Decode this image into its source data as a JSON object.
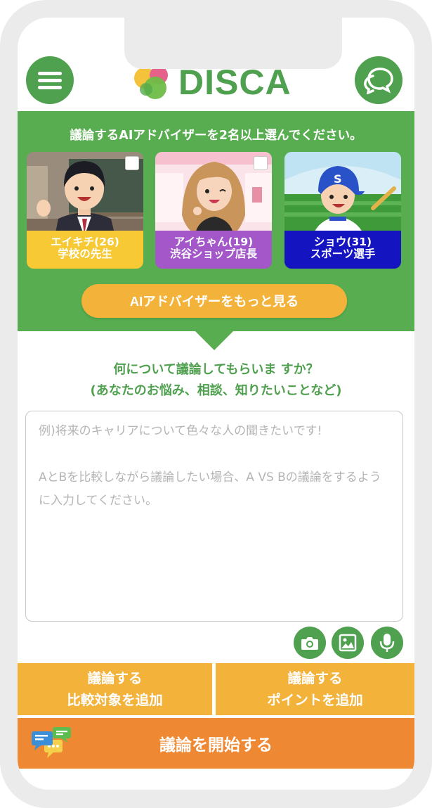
{
  "header": {
    "logo_text": "DISCA",
    "menu_icon": "hamburger-menu-icon",
    "chat_icon": "chat-bubbles-icon"
  },
  "advisor_panel": {
    "title": "議論するAIアドバイザーを2名以上選んでください。",
    "advisors": [
      {
        "name": "エイキチ(26)",
        "role": "学校の先生",
        "caption_color": "#f7c934",
        "text_color": "#ffffff"
      },
      {
        "name": "アイちゃん(19)",
        "role": "渋谷ショップ店長",
        "caption_color": "#a357c9",
        "text_color": "#ffffff"
      },
      {
        "name": "ショウ(31)",
        "role": "スポーツ選手",
        "caption_color": "#1414c0",
        "text_color": "#ffffff"
      }
    ],
    "more_button": "AIアドバイザーをもっと見る"
  },
  "question": {
    "line1": "何について議論してもらいま すか？",
    "line2": "(あなたのお悩み、相談、知りたいことなど)"
  },
  "topic_input": {
    "placeholder": "例)将来のキャリアについて色々な人の聞きたいです!\n\nAとBを比較しながら議論したい場合、A VS Bの議論をするように入力してください。"
  },
  "tools": [
    "camera-icon",
    "image-icon",
    "microphone-icon"
  ],
  "actions": {
    "add_compare_line1": "議論する",
    "add_compare_line2": "比較対象を追加",
    "add_point_line1": "議論する",
    "add_point_line2": "ポイントを追加",
    "start": "議論を開始する"
  },
  "colors": {
    "brand_green": "#4fa04f",
    "panel_green": "#57ad4f",
    "orange_light": "#f3b23a",
    "orange_dark": "#ef8833"
  }
}
